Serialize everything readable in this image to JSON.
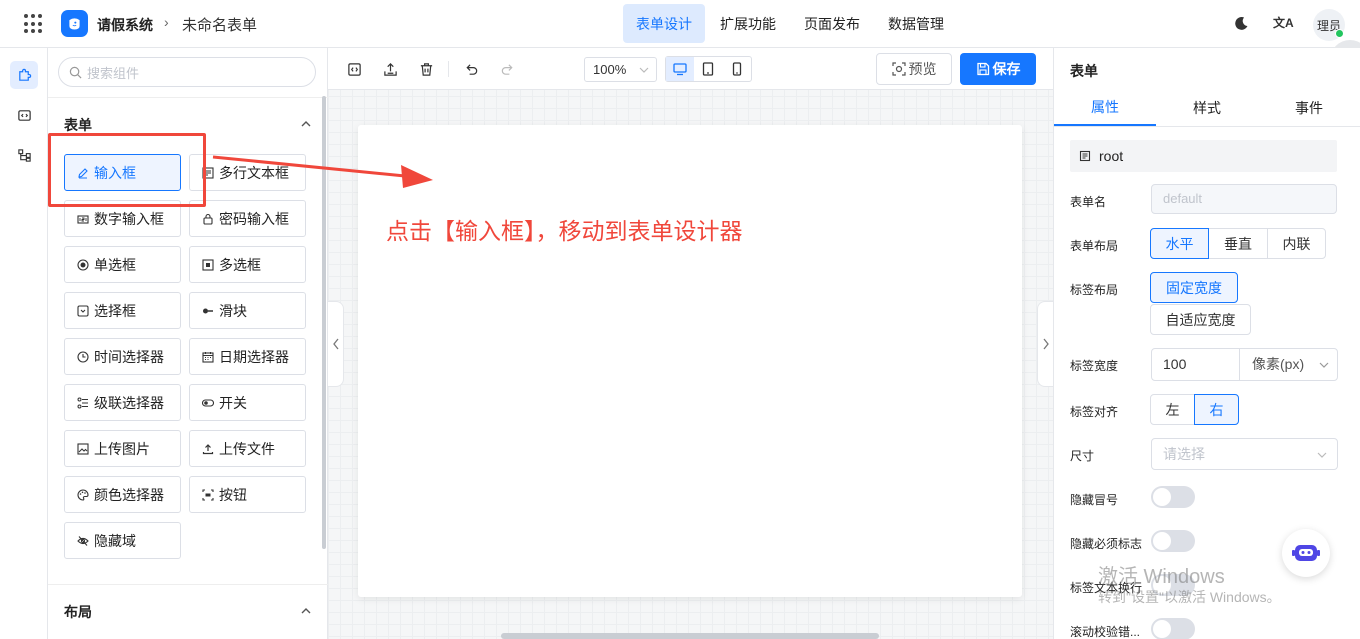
{
  "header": {
    "app_name": "请假系统",
    "breadcrumb_sep": "›",
    "form_name": "未命名表单",
    "tabs": [
      {
        "label": "表单设计",
        "active": true
      },
      {
        "label": "扩展功能",
        "active": false
      },
      {
        "label": "页面发布",
        "active": false
      },
      {
        "label": "数据管理",
        "active": false
      }
    ],
    "translate_glyph": "文A",
    "user": "理员"
  },
  "components": {
    "search_placeholder": "搜索组件",
    "group_form": "表单",
    "items": [
      {
        "label": "输入框",
        "icon": "edit-icon",
        "selected": true
      },
      {
        "label": "多行文本框",
        "icon": "textarea-icon",
        "selected": false
      },
      {
        "label": "数字输入框",
        "icon": "number-icon",
        "selected": false
      },
      {
        "label": "密码输入框",
        "icon": "lock-icon",
        "selected": false
      },
      {
        "label": "单选框",
        "icon": "radio-icon",
        "selected": false
      },
      {
        "label": "多选框",
        "icon": "checkbox-icon",
        "selected": false
      },
      {
        "label": "选择框",
        "icon": "select-icon",
        "selected": false
      },
      {
        "label": "滑块",
        "icon": "slider-icon",
        "selected": false
      },
      {
        "label": "时间选择器",
        "icon": "clock-icon",
        "selected": false
      },
      {
        "label": "日期选择器",
        "icon": "calendar-icon",
        "selected": false
      },
      {
        "label": "级联选择器",
        "icon": "cascader-icon",
        "selected": false
      },
      {
        "label": "开关",
        "icon": "switch-icon",
        "selected": false
      },
      {
        "label": "上传图片",
        "icon": "image-icon",
        "selected": false
      },
      {
        "label": "上传文件",
        "icon": "upload-icon",
        "selected": false
      },
      {
        "label": "颜色选择器",
        "icon": "palette-icon",
        "selected": false
      },
      {
        "label": "按钮",
        "icon": "button-icon",
        "selected": false
      },
      {
        "label": "隐藏域",
        "icon": "eye-off-icon",
        "selected": false
      }
    ],
    "group_layout": "布局"
  },
  "toolbar": {
    "zoom": "100%",
    "preview_label": "预览",
    "save_label": "保存"
  },
  "canvas": {
    "annotation": "点击【输入框】，移动到表单设计器"
  },
  "properties": {
    "title": "表单",
    "tabs": [
      {
        "label": "属性",
        "active": true
      },
      {
        "label": "样式",
        "active": false
      },
      {
        "label": "事件",
        "active": false
      }
    ],
    "root_label": "root",
    "form_name_label": "表单名",
    "form_name_placeholder": "default",
    "form_layout_label": "表单布局",
    "form_layout_options": [
      "水平",
      "垂直",
      "内联"
    ],
    "form_layout_selected": "水平",
    "label_layout_label": "标签布局",
    "label_layout_fixed": "固定宽度",
    "label_layout_adaptive": "自适应宽度",
    "label_width_label": "标签宽度",
    "label_width_value": "100",
    "label_width_unit": "像素(px)",
    "label_align_label": "标签对齐",
    "label_align_options": [
      "左",
      "右"
    ],
    "label_align_selected": "右",
    "size_label": "尺寸",
    "size_placeholder": "请选择",
    "hide_colon_label": "隐藏冒号",
    "hide_required_label": "隐藏必须标志",
    "label_wrap_label": "标签文本换行",
    "scroll_validate_label": "滚动校验错..."
  },
  "watermark": {
    "line1": "激活 Windows",
    "line2": "转到\"设置\"以激活 Windows。"
  },
  "colors": {
    "accent": "#1677ff",
    "annotation": "#f0473b"
  }
}
